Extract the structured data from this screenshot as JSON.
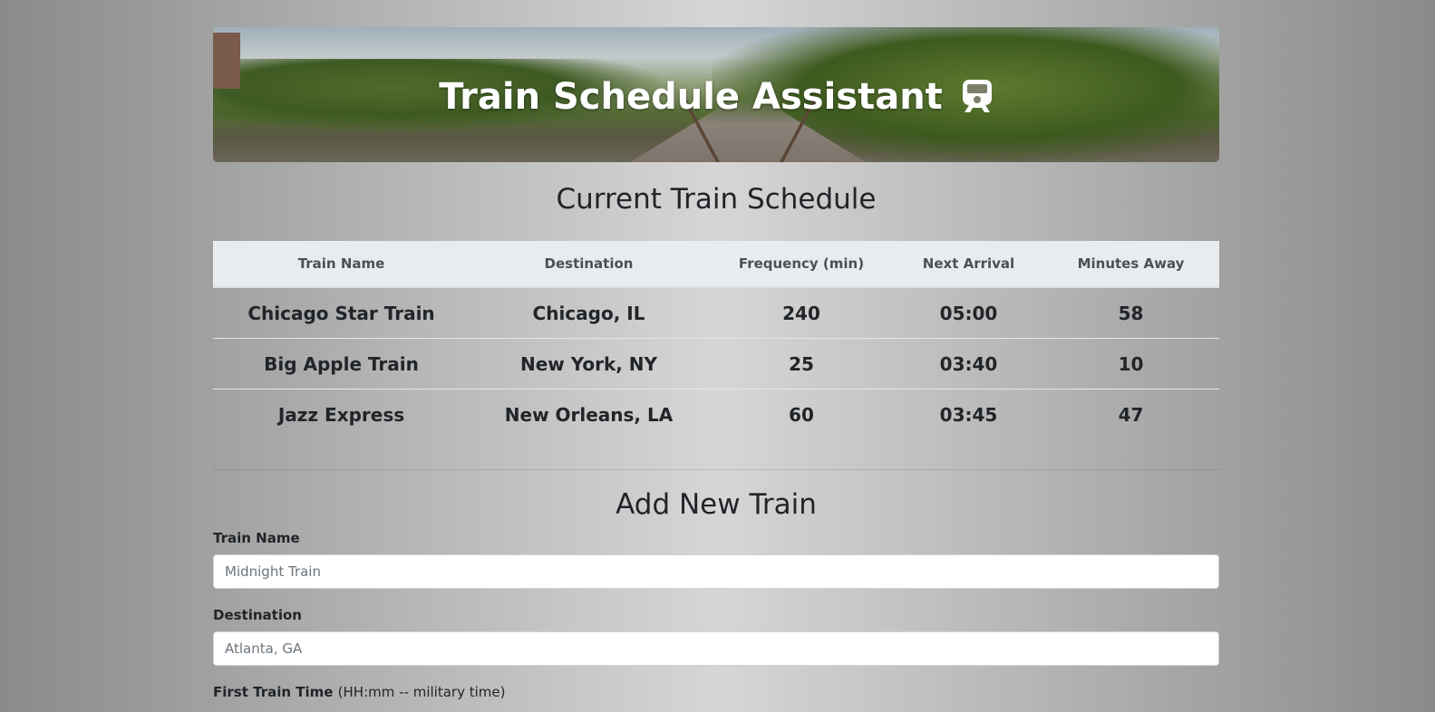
{
  "header": {
    "title": "Train Schedule Assistant",
    "icon": "train-icon"
  },
  "schedule": {
    "heading": "Current Train Schedule",
    "columns": [
      "Train Name",
      "Destination",
      "Frequency (min)",
      "Next Arrival",
      "Minutes Away"
    ],
    "rows": [
      [
        "Chicago Star Train",
        "Chicago, IL",
        "240",
        "05:00",
        "58"
      ],
      [
        "Big Apple Train",
        "New York, NY",
        "25",
        "03:40",
        "10"
      ],
      [
        "Jazz Express",
        "New Orleans, LA",
        "60",
        "03:45",
        "47"
      ]
    ]
  },
  "form": {
    "heading": "Add New Train",
    "train_name": {
      "label": "Train Name",
      "placeholder": "Midnight Train"
    },
    "destination": {
      "label": "Destination",
      "placeholder": "Atlanta, GA"
    },
    "first_train_time": {
      "label": "First Train Time",
      "hint": "(HH:mm -- military time)"
    }
  }
}
